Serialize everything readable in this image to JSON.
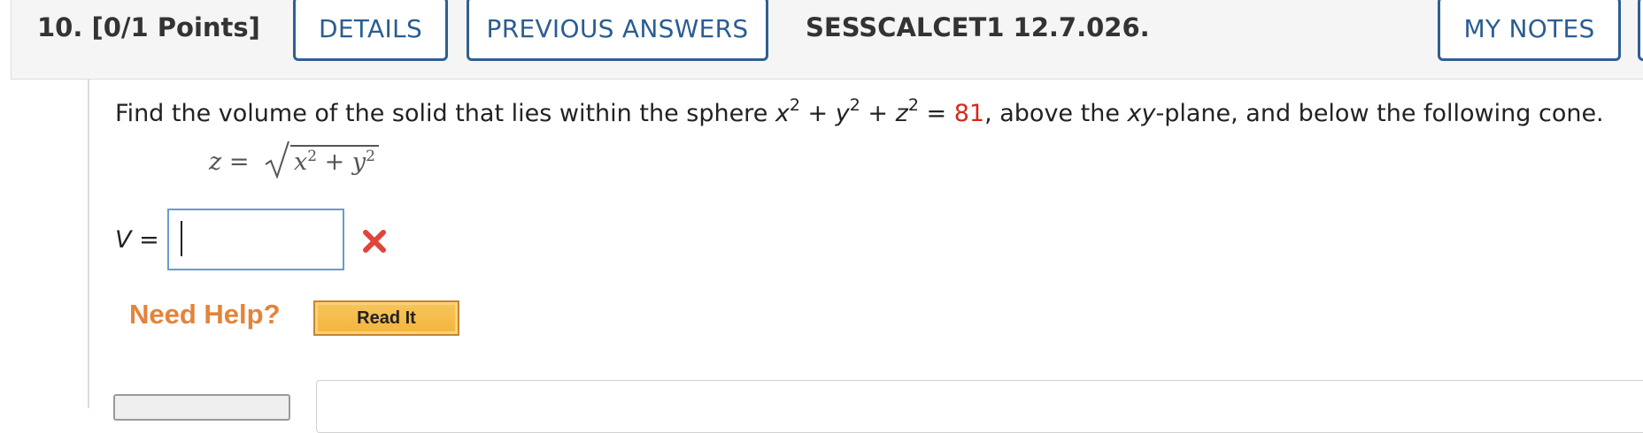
{
  "header": {
    "question_number": "10.",
    "points": "[0/1 Points]",
    "details_label": "DETAILS",
    "previous_answers_label": "PREVIOUS ANSWERS",
    "question_code": "SESSCALCET1 12.7.026.",
    "my_notes_label": "MY NOTES"
  },
  "question": {
    "text_1": "Find the volume of the solid that lies within the sphere ",
    "var_x": "x",
    "var_y": "y",
    "var_z": "z",
    "exp": "2",
    "plus": " + ",
    "equals": " = ",
    "value": "81",
    "text_2": ", above the ",
    "xy": "xy",
    "text_3": "-plane, and below the following cone."
  },
  "equation": {
    "lhs": "z",
    "equals": " = ",
    "radicand_x": "x",
    "radicand_y": "y",
    "exp": "2",
    "plus": " + "
  },
  "answer": {
    "variable": "V",
    "equals": " =",
    "value": "",
    "status": "incorrect",
    "status_icon": "x-mark-icon",
    "status_color": "#e0443a"
  },
  "help": {
    "need_help_label": "Need Help?",
    "read_it_label": "Read It"
  },
  "colors": {
    "accent": "#2f5f91",
    "highlight_value": "#d5281b",
    "help_orange": "#e4833a"
  }
}
